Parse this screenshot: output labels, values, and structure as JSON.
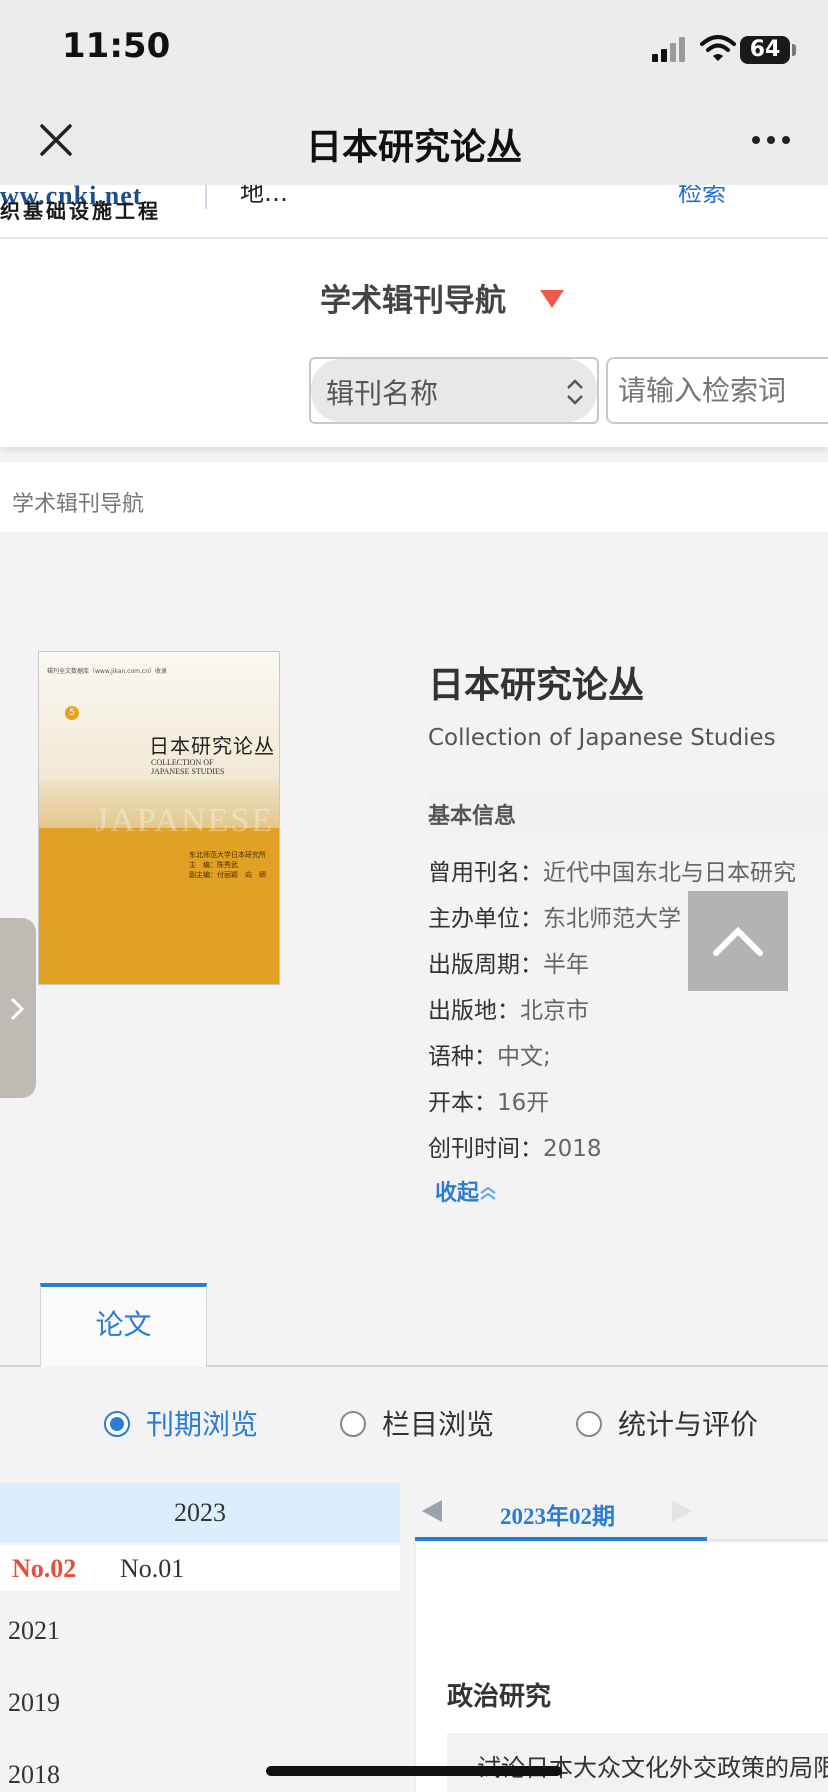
{
  "status_bar": {
    "time": "11:50",
    "battery": "64"
  },
  "nav": {
    "title": "日本研究论丛",
    "close_icon": "close-icon",
    "more_icon": "more-icon"
  },
  "header": {
    "logo_text": "ww.cnki.net",
    "logo_subtitle": "织基础设施工程",
    "fragment_1": "地…",
    "fragment_2": "检索"
  },
  "search": {
    "nav_dropdown_label": "学术辑刊导航",
    "field_select_value": "辑刊名称",
    "input_placeholder": "请输入检索词"
  },
  "breadcrumb": "学术辑刊导航",
  "journal": {
    "title": "日本研究论丛",
    "title_en": "Collection of Japanese Studies",
    "info_heading": "基本信息",
    "info": [
      {
        "label": "曾用刊名：",
        "value": "近代中国东北与日本研究"
      },
      {
        "label": "主办单位：",
        "value": "东北师范大学"
      },
      {
        "label": "出版周期：",
        "value": "半年"
      },
      {
        "label": "出版地：",
        "value": "北京市"
      },
      {
        "label": "语种：",
        "value": "中文;"
      },
      {
        "label": "开本：",
        "value": "16开"
      },
      {
        "label": "创刊时间：",
        "value": "2018"
      }
    ],
    "collapse_label": "收起",
    "cover": {
      "publisher": "辑刊全文数据库（www.jikan.com.cn）收录",
      "volume": "5",
      "title": "日本研究论丛",
      "title_en_1": "COLLECTION OF",
      "title_en_2": "JAPANESE STUDIES",
      "watermark": "JAPANESE",
      "editor_1": "东北师范大学日本研究所",
      "editor_2": "主　编：陈秀武",
      "editor_3": "副主编：付丽颖　向　卿"
    }
  },
  "tabs": [
    {
      "label": "论文",
      "active": true
    }
  ],
  "browse_modes": [
    {
      "label": "刊期浏览",
      "selected": true
    },
    {
      "label": "栏目浏览",
      "selected": false
    },
    {
      "label": "统计与评价",
      "selected": false
    }
  ],
  "years": {
    "expanded_year": "2023",
    "issues": [
      {
        "label": "No.02",
        "active": true
      },
      {
        "label": "No.01",
        "active": false
      }
    ],
    "others": [
      "2021",
      "2019",
      "2018"
    ]
  },
  "issue_panel": {
    "current_issue": "2023年02期",
    "section_title": "政治研究",
    "first_article": "试论日本大众文化外交政策的局限"
  },
  "colors": {
    "accent": "#2b7cd3",
    "active_issue": "#e5503a",
    "year_highlight": "#dbeefc"
  }
}
